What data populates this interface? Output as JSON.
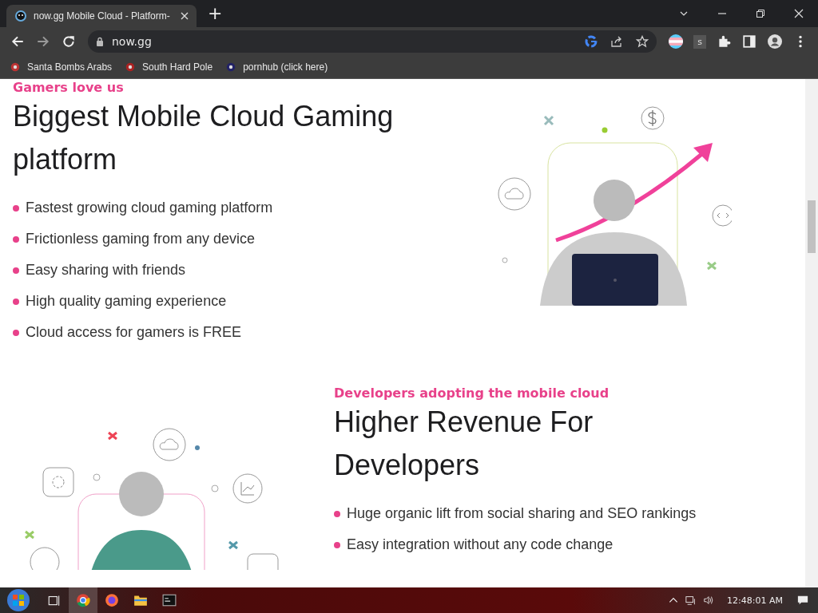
{
  "browser": {
    "tabs": [
      {
        "title": "now.gg Mobile Cloud - Platform-",
        "selected": true
      }
    ],
    "new_tab": "+",
    "address": "now.gg",
    "extension_badge": "s",
    "bookmarks": [
      {
        "label": "Santa Bombs Arabs"
      },
      {
        "label": "South Hard Pole"
      },
      {
        "label": "pornhub (click here)"
      }
    ]
  },
  "sections": [
    {
      "eyebrow": "Gamers love us",
      "heading": "Biggest Mobile Cloud Gaming platform",
      "bullets": [
        "Fastest growing cloud gaming platform",
        "Frictionless gaming from any device",
        "Easy sharing with friends",
        "High quality gaming experience",
        "Cloud access for gamers is FREE"
      ]
    },
    {
      "eyebrow": "Developers adopting the mobile cloud",
      "heading": "Higher Revenue For Developers",
      "bullets": [
        "Huge organic lift from social sharing and SEO rankings",
        "Easy integration without any code change"
      ]
    }
  ],
  "taskbar": {
    "clock": "12:48:01 AM"
  }
}
